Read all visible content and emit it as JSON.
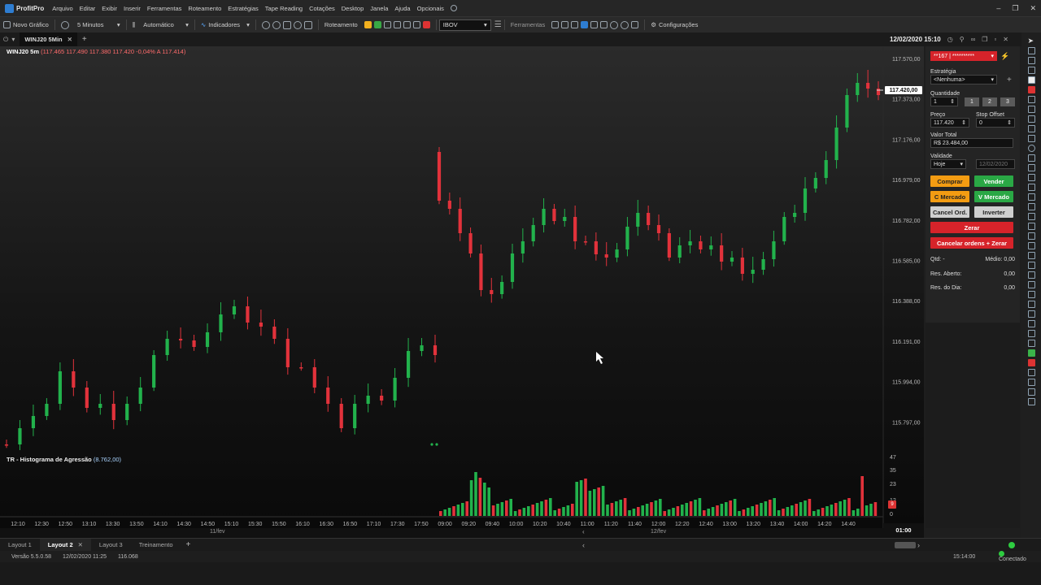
{
  "app": {
    "name": "ProfitPro"
  },
  "menu": [
    "Arquivo",
    "Editar",
    "Exibir",
    "Inserir",
    "Ferramentas",
    "Roteamento",
    "Estratégias",
    "Tape Reading",
    "Cotações",
    "Desktop",
    "Janela",
    "Ajuda",
    "Opcionais"
  ],
  "toolbar": {
    "new_chart": "Novo Gráfico",
    "timeframe": "5 Minutos",
    "mode": "Automático",
    "indicators": "Indicadores",
    "routing": "Roteamento",
    "asset": "IBOV",
    "tools": "Ferramentas",
    "settings": "Configurações"
  },
  "chart_tab": {
    "label": "WINJ20 5Min",
    "datetime": "12/02/2020 15:10"
  },
  "chart_header": {
    "symbol": "WINJ20 5m",
    "values": "(117.465  117.490  117.380  117.420  -0,04%  A 117.414)"
  },
  "indicator": {
    "title": "TR - Histograma de Agressão",
    "value": "(8.762,00)"
  },
  "price_axis": [
    "117.570,00",
    "117.373,00",
    "117.176,00",
    "116.979,00",
    "116.782,00",
    "116.585,00",
    "116.388,00",
    "116.191,00",
    "115.994,00",
    "115.797,00"
  ],
  "current_price": "117.420,00",
  "volume_axis": [
    "47",
    "35",
    "23",
    "12",
    "0"
  ],
  "volume_badge": "9",
  "time_axis": [
    "12:10",
    "12:30",
    "12:50",
    "13:10",
    "13:30",
    "13:50",
    "14:10",
    "14:30",
    "14:50",
    "15:10",
    "15:30",
    "15:50",
    "16:10",
    "16:30",
    "16:50",
    "17:10",
    "17:30",
    "17:50",
    "09:00",
    "09:20",
    "09:40",
    "10:00",
    "10:20",
    "10:40",
    "11:00",
    "11:20",
    "11:40",
    "12:00",
    "12:20",
    "12:40",
    "13:00",
    "13:20",
    "13:40",
    "14:00",
    "14:20",
    "14:40"
  ],
  "dates": [
    "11/fev",
    "12/fev"
  ],
  "time_box": "01:00",
  "panel": {
    "account": "**167 | **********",
    "strategy_label": "Estratégia",
    "strategy_value": "<Nenhuma>",
    "qty_label": "Quantidade",
    "qty_value": "1",
    "qty_presets": [
      "1",
      "2",
      "3"
    ],
    "price_label": "Preço",
    "price_value": "117.420",
    "stop_label": "Stop Offset",
    "stop_value": "0",
    "total_label": "Valor Total",
    "total_value": "R$ 23.484,00",
    "validity_label": "Validade",
    "validity_value": "Hoje",
    "validity_date": "12/02/2020",
    "buy": "Comprar",
    "sell": "Vender",
    "buy_market": "C Mercado",
    "sell_market": "V Mercado",
    "cancel_orders": "Cancel Ord.",
    "invert": "Inverter",
    "zero": "Zerar",
    "cancel_zero": "Cancelar ordens + Zerar",
    "qtd_label": "Qtd:",
    "qtd_value": "-",
    "avg_label": "Médio:",
    "avg_value": "0,00",
    "open_label": "Res. Aberto:",
    "open_value": "0,00",
    "day_label": "Res. do Dia:",
    "day_value": "0,00"
  },
  "layouts": [
    "Layout 1",
    "Layout 2",
    "Layout 3",
    "Treinamento"
  ],
  "status": {
    "version": "Versão 5.5.0.58",
    "datetime": "12/02/2020 11:25",
    "value": "116.068",
    "clock": "15:14:00",
    "connection": "Conectado"
  },
  "colors": {
    "up": "#22b24c",
    "down": "#e2323b",
    "accent": "#2e7dd1"
  }
}
